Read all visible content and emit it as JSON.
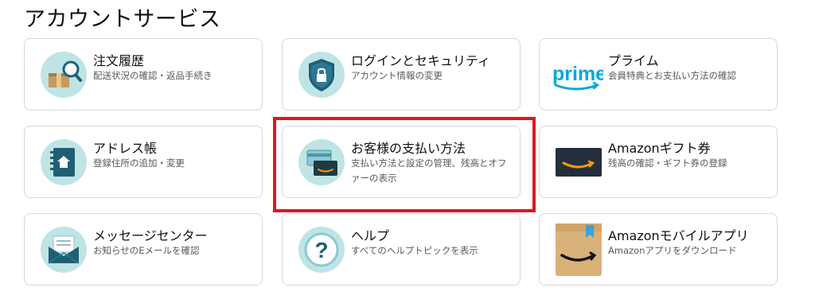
{
  "page": {
    "title": "アカウントサービス"
  },
  "cards": [
    {
      "title": "注文履歴",
      "desc": "配送状況の確認・返品手続き",
      "icon": "order-history-icon"
    },
    {
      "title": "ログインとセキュリティ",
      "desc": "アカウント情報の変更",
      "icon": "security-shield-icon"
    },
    {
      "title": "プライム",
      "desc": "会員特典とお支払い方法の確認",
      "icon": "prime-logo-icon",
      "logo_text": "prime"
    },
    {
      "title": "アドレス帳",
      "desc": "登録住所の追加・変更",
      "icon": "address-book-icon"
    },
    {
      "title": "お客様の支払い方法",
      "desc": "支払い方法と設定の管理、残高とオファーの表示",
      "icon": "payment-cards-icon"
    },
    {
      "title": "Amazonギフト券",
      "desc": "残高の確認・ギフト券の登録",
      "icon": "gift-card-icon"
    },
    {
      "title": "メッセージセンター",
      "desc": "お知らせのEメールを確認",
      "icon": "message-envelope-icon"
    },
    {
      "title": "ヘルプ",
      "desc": "すべてのヘルプトピックを表示",
      "icon": "help-question-icon",
      "glyph": "?"
    },
    {
      "title": "Amazonモバイルアプリ",
      "desc": "Amazonアプリをダウンロード",
      "icon": "amazon-app-icon"
    }
  ],
  "colors": {
    "icon_bg": "#bfe4e6",
    "icon_dark": "#1f5f74",
    "highlight": "#e2161e",
    "prime_blue": "#00a8e1",
    "amazon_orange": "#ff9900"
  }
}
